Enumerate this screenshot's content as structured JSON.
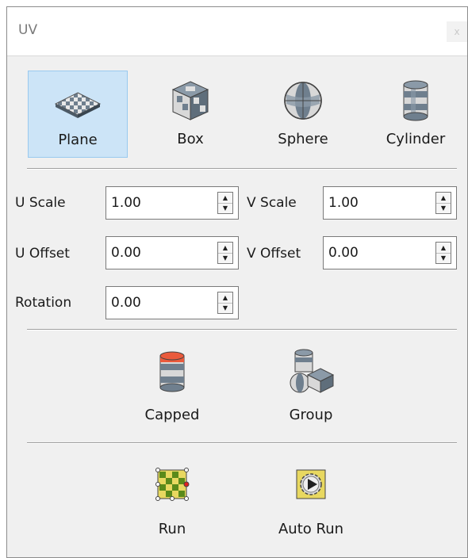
{
  "window": {
    "title": "UV",
    "close_label": "x"
  },
  "projections": [
    {
      "label": "Plane",
      "icon": "plane-icon",
      "selected": true
    },
    {
      "label": "Box",
      "icon": "box-icon",
      "selected": false
    },
    {
      "label": "Sphere",
      "icon": "sphere-icon",
      "selected": false
    },
    {
      "label": "Cylinder",
      "icon": "cylinder-icon",
      "selected": false
    }
  ],
  "fields": {
    "u_scale": {
      "label": "U Scale",
      "value": "1.00"
    },
    "v_scale": {
      "label": "V Scale",
      "value": "1.00"
    },
    "u_offset": {
      "label": "U Offset",
      "value": "0.00"
    },
    "v_offset": {
      "label": "V Offset",
      "value": "0.00"
    },
    "rotation": {
      "label": "Rotation",
      "value": "0.00"
    }
  },
  "options": [
    {
      "label": "Capped",
      "icon": "capped-cylinder-icon"
    },
    {
      "label": "Group",
      "icon": "group-icon"
    }
  ],
  "actions": [
    {
      "label": "Run",
      "icon": "run-icon"
    },
    {
      "label": "Auto Run",
      "icon": "auto-run-icon"
    }
  ],
  "colors": {
    "selected_bg": "#cce4f7",
    "selected_border": "#99c9ef",
    "icon_gray": "#8b9aa8",
    "icon_light": "#e8e8e8",
    "cap_red": "#ea5a3c",
    "grid_green": "#5a8a1a",
    "grid_yellow": "#e8d860"
  }
}
